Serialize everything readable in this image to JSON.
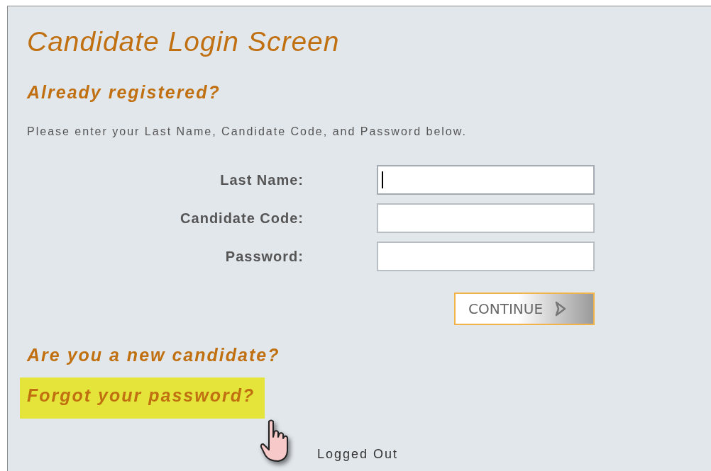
{
  "title": "Candidate Login Screen",
  "registered_heading": "Already registered?",
  "instructions": "Please enter your Last Name, Candidate Code, and Password below.",
  "fields": [
    {
      "label": "Last Name:",
      "focused": true
    },
    {
      "label": "Candidate Code:",
      "focused": false
    },
    {
      "label": "Password:",
      "focused": false
    }
  ],
  "continue_button": "CONTINUE",
  "new_candidate_link": "Are you a new candidate?",
  "forgot_link": {
    "label": "Forgot your password?",
    "highlighted": true
  },
  "status": "Logged Out"
}
